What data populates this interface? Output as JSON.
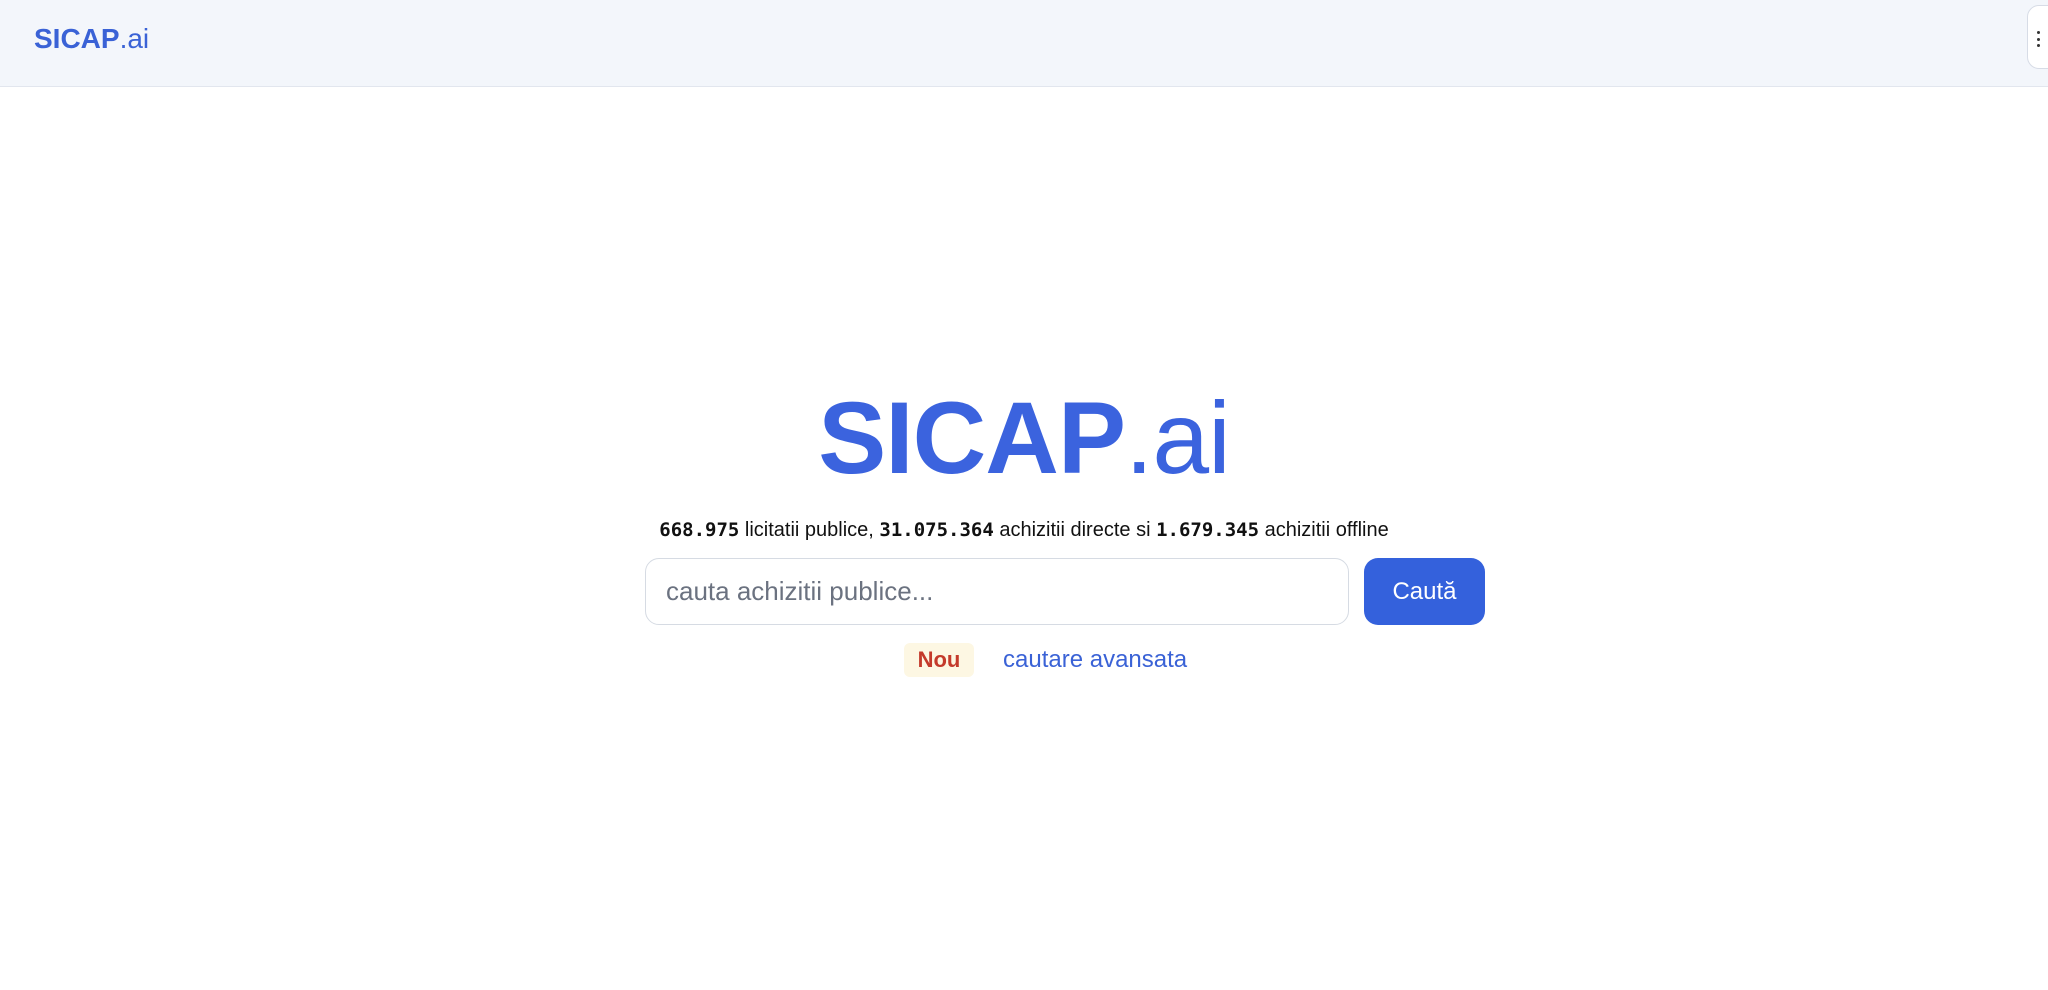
{
  "header": {
    "brand_bold": "SICAP",
    "brand_light": ".ai",
    "menu_icon": "kebab-menu-icon"
  },
  "hero": {
    "title_bold": "SICAP",
    "title_light": ".ai"
  },
  "stats": {
    "licitatii_count": "668.975",
    "licitatii_label": " licitatii publice, ",
    "directe_count": "31.075.364",
    "directe_label": " achizitii directe si ",
    "offline_count": "1.679.345",
    "offline_label": " achizitii offline"
  },
  "search": {
    "placeholder": "cauta achizitii publice...",
    "value": "",
    "button_label": "Caută"
  },
  "links": {
    "badge": "Nou",
    "advanced_search": "cautare avansata"
  },
  "colors": {
    "brand": "#3b63de",
    "button": "#3461dc",
    "badge_text": "#c43a2b",
    "badge_bg": "#fdf7e3",
    "header_bg": "#f3f6fb"
  }
}
